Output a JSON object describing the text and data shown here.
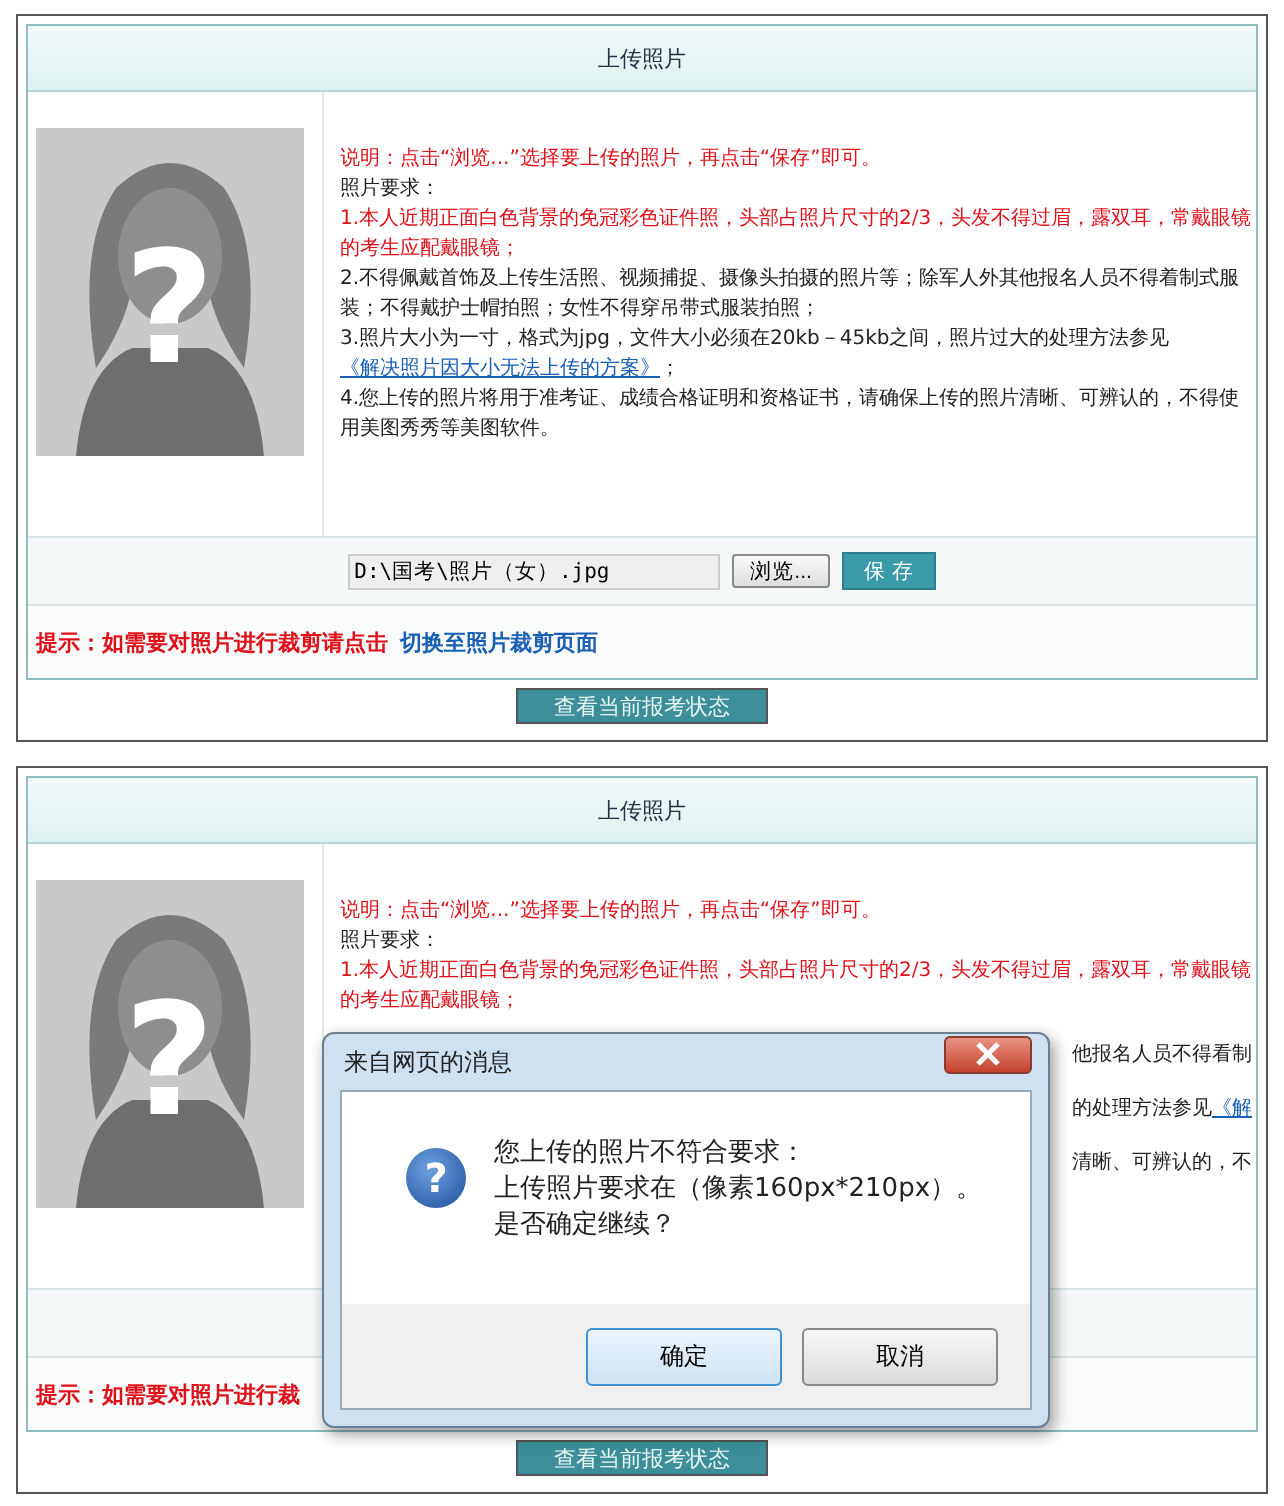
{
  "panels": [
    {
      "header": "上传照片",
      "avatar_mark": "?",
      "notes": [
        {
          "kind": "alert",
          "text": "说明：点击“浏览...”选择要上传的照片，再点击“保存”即可。"
        },
        {
          "kind": "plain",
          "text": "照片要求："
        },
        {
          "kind": "alert",
          "text": "1.本人近期正面白色背景的免冠彩色证件照，头部占照片尺寸的2/3，头发不得过眉，露双耳，常戴眼镜的考生应配戴眼镜；"
        },
        {
          "kind": "plain",
          "text": "2.不得佩戴首饰及上传生活照、视频捕捉、摄像头拍摄的照片等；除军人外其他报名人员不得着制式服装；不得戴护士帽拍照；女性不得穿吊带式服装拍照；"
        },
        {
          "kind": "plain",
          "text": "3.照片大小为一寸，格式为jpg，文件大小必须在20kb－45kb之间，照片过大的处理方法参见",
          "link": "《解决照片因大小无法上传的方案》",
          "tail": "；"
        },
        {
          "kind": "plain",
          "text": "4.您上传的照片将用于准考证、成绩合格证明和资格证书，请确保上传的照片清晰、可辨认的，不得使用美图秀秀等美图软件。"
        }
      ],
      "upload": {
        "value": "D:\\国考\\照片（女）.jpg",
        "browse": "浏览...",
        "save": "保 存"
      },
      "hint": {
        "text": "提示：如需要对照片进行裁剪请点击",
        "link": "切换至照片裁剪页面"
      },
      "status_button": "查看当前报考状态"
    },
    {
      "header": "上传照片",
      "avatar_mark": "?",
      "notes": [
        {
          "kind": "alert",
          "text": "说明：点击“浏览...”选择要上传的照片，再点击“保存”即可。"
        },
        {
          "kind": "plain",
          "text": "照片要求："
        },
        {
          "kind": "alert",
          "text": "1.本人近期正面白色背景的免冠彩色证件照，头部占照片尺寸的2/3，头发不得过眉，露双耳，常戴眼镜的考生应配戴眼镜；"
        },
        {
          "kind": "fragment",
          "text": "他报名人员不得看制"
        },
        {
          "kind": "fragment",
          "text": "的处理方法参见",
          "link": "《解"
        },
        {
          "kind": "fragment",
          "text": "清晰、可辨认的，不"
        }
      ],
      "hint": {
        "text": "提示：如需要对照片进行裁"
      },
      "status_button": "查看当前报考状态",
      "dialog": {
        "title": "来自网页的消息",
        "icon_glyph": "?",
        "message": [
          "您上传的照片不符合要求：",
          "上传照片要求在（像素160px*210px）。",
          "是否确定继续？"
        ],
        "buttons": [
          {
            "label": "确定",
            "selected": true
          },
          {
            "label": "取消",
            "selected": false
          }
        ]
      }
    }
  ]
}
